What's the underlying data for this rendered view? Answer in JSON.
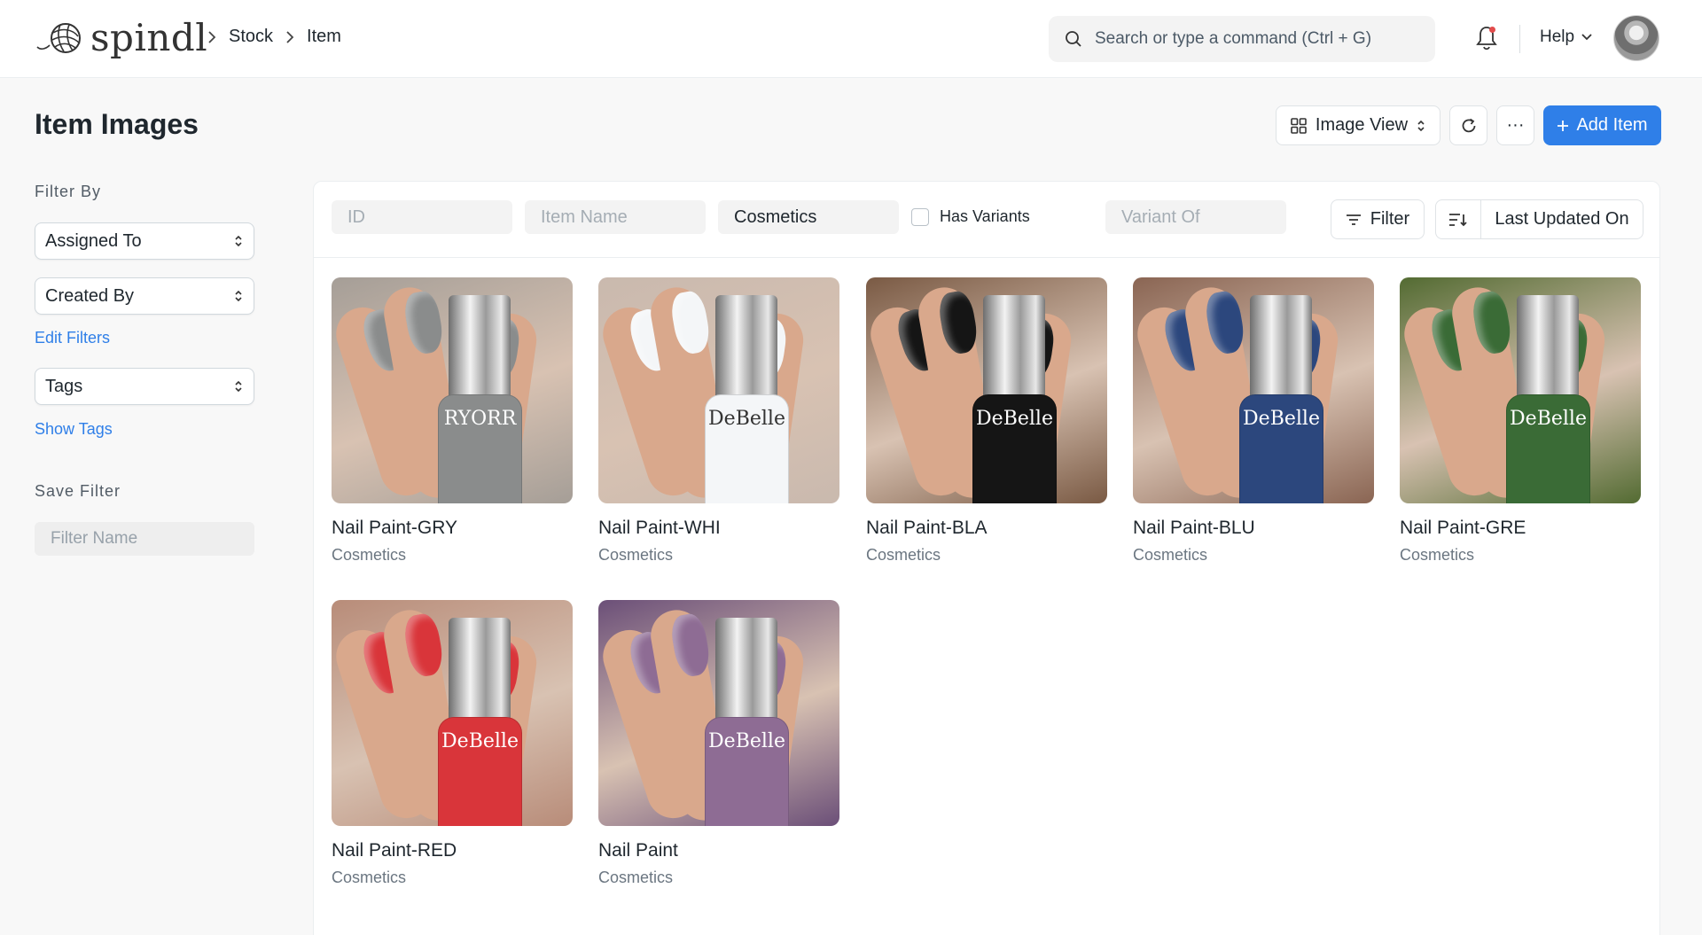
{
  "app": {
    "logo_text": "spindl"
  },
  "breadcrumbs": [
    "Stock",
    "Item"
  ],
  "search": {
    "placeholder": "Search or type a command (Ctrl + G)"
  },
  "nav": {
    "help_label": "Help"
  },
  "page": {
    "title": "Item Images"
  },
  "toolbar": {
    "view_label": "Image View",
    "more_label": "···",
    "add_label": "Add Item"
  },
  "sidebar": {
    "filter_by_label": "Filter By",
    "assigned_to_label": "Assigned To",
    "created_by_label": "Created By",
    "edit_filters_label": "Edit Filters",
    "tags_label": "Tags",
    "show_tags_label": "Show Tags",
    "save_filter_label": "Save Filter",
    "filter_name_placeholder": "Filter Name"
  },
  "filters": {
    "id_placeholder": "ID",
    "item_name_placeholder": "Item Name",
    "item_group_value": "Cosmetics",
    "has_variants_label": "Has Variants",
    "variant_of_placeholder": "Variant Of",
    "filter_button_label": "Filter",
    "sort_label": "Last Updated On"
  },
  "items": [
    {
      "title": "Nail Paint-GRY",
      "group": "Cosmetics",
      "color": "#8a8c8c",
      "bg": "#a59e97",
      "brand": "RYORR"
    },
    {
      "title": "Nail Paint-WHI",
      "group": "Cosmetics",
      "color": "#f4f6f8",
      "bg": "#c9b9ae",
      "brand": "DeBelle"
    },
    {
      "title": "Nail Paint-BLA",
      "group": "Cosmetics",
      "color": "#151515",
      "bg": "#7a5a44",
      "brand": "DeBelle"
    },
    {
      "title": "Nail Paint-BLU",
      "group": "Cosmetics",
      "color": "#2c477d",
      "bg": "#8a6553",
      "brand": "DeBelle"
    },
    {
      "title": "Nail Paint-GRE",
      "group": "Cosmetics",
      "color": "#3a6b36",
      "bg": "#536b32",
      "brand": "DeBelle"
    },
    {
      "title": "Nail Paint-RED",
      "group": "Cosmetics",
      "color": "#d9353a",
      "bg": "#b88c79",
      "brand": "DeBelle"
    },
    {
      "title": "Nail Paint",
      "group": "Cosmetics",
      "color": "#8e6c94",
      "bg": "#6b4f78",
      "brand": "DeBelle"
    }
  ],
  "colors": {
    "accent": "#2f7fe8",
    "notification_dot": "#e24c4c"
  }
}
